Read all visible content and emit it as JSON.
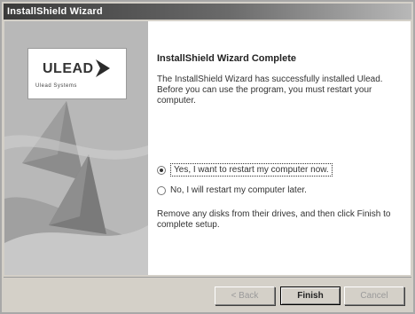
{
  "window": {
    "title": "InstallShield Wizard"
  },
  "side_panel": {
    "logo_text": "ULEAD",
    "logo_tagline": "Ulead Systems"
  },
  "content": {
    "heading": "InstallShield Wizard Complete",
    "paragraph": "The InstallShield Wizard has successfully installed Ulead. Before you can use the program, you must restart your computer.",
    "options": [
      {
        "label": "Yes, I want to restart my computer now.",
        "checked": true
      },
      {
        "label": "No, I will restart my computer later.",
        "checked": false
      }
    ],
    "note": "Remove any disks from their drives, and then click Finish to complete setup."
  },
  "buttons": {
    "back": "< Back",
    "finish": "Finish",
    "cancel": "Cancel"
  }
}
